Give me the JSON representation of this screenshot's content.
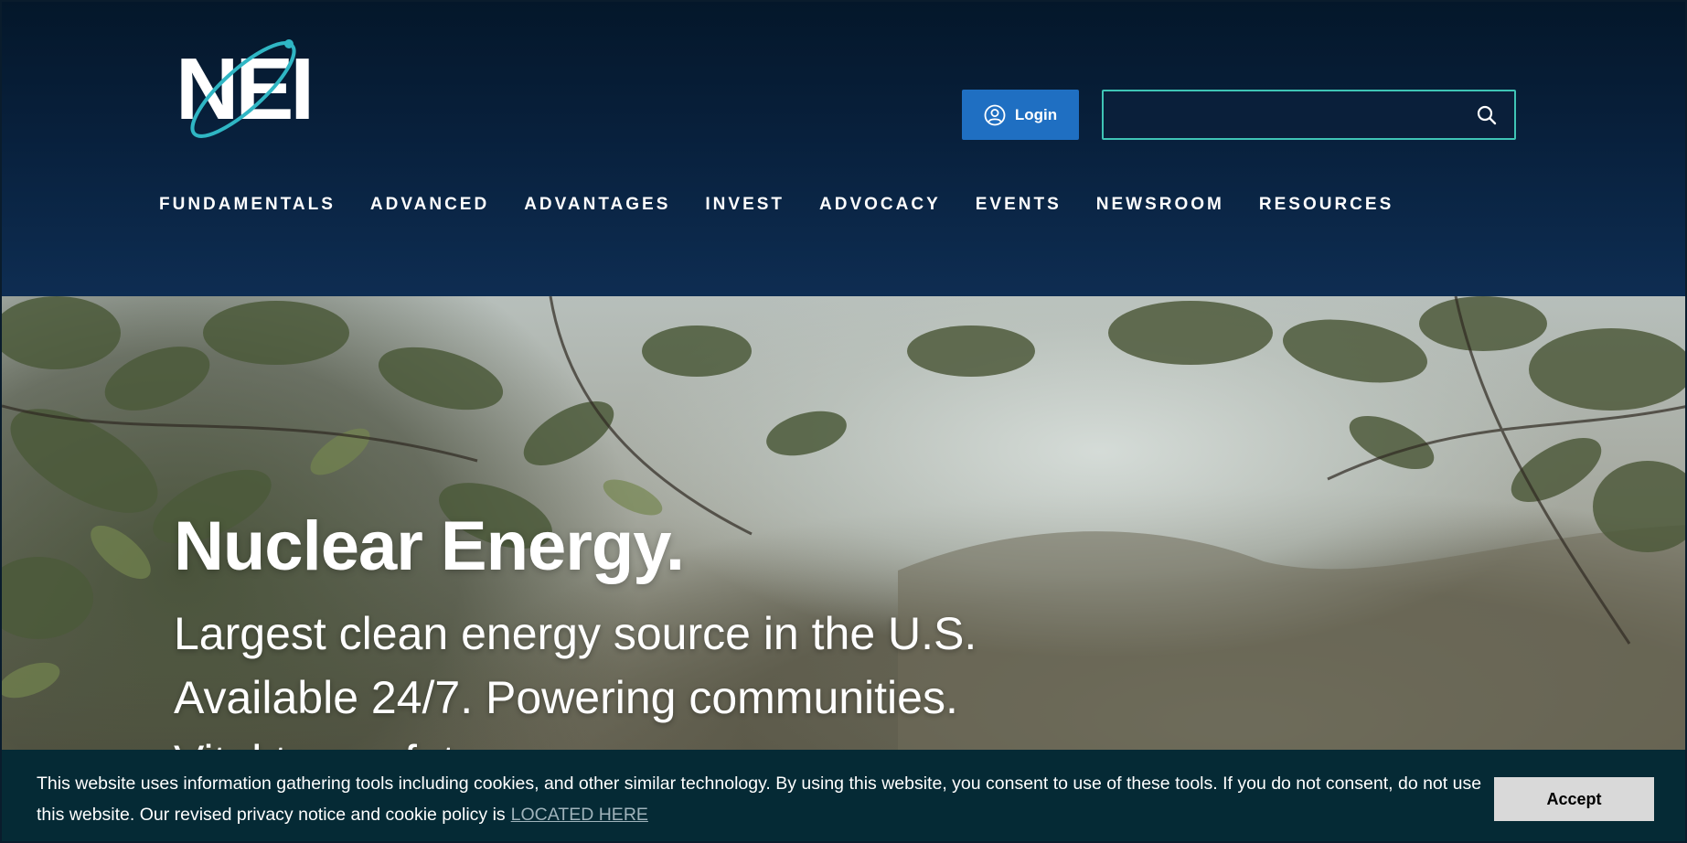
{
  "header": {
    "logo_text": "NEI",
    "login_label": "Login",
    "search": {
      "placeholder": "",
      "value": ""
    }
  },
  "nav": {
    "items": [
      {
        "label": "FUNDAMENTALS"
      },
      {
        "label": "ADVANCED"
      },
      {
        "label": "ADVANTAGES"
      },
      {
        "label": "INVEST"
      },
      {
        "label": "ADVOCACY"
      },
      {
        "label": "EVENTS"
      },
      {
        "label": "NEWSROOM"
      },
      {
        "label": "RESOURCES"
      }
    ]
  },
  "hero": {
    "title": "Nuclear Energy.",
    "line1": "Largest clean energy source in the U.S.",
    "line2": "Available 24/7. Powering communities.",
    "line3": "Vital to our future."
  },
  "cookie_banner": {
    "text": "This website uses information gathering tools including cookies, and other similar technology. By using this website, you consent to use of these tools. If you do not consent, do not use this website. Our revised privacy notice and cookie policy is",
    "link_label": "LOCATED HERE",
    "accept_label": "Accept"
  },
  "colors": {
    "header_dark": "#04172a",
    "header_light": "#0e2d52",
    "login_blue": "#1f6fc2",
    "search_border": "#3fc4b5",
    "logo_orbit": "#2fb6c4",
    "cookie_bg": "#052a35",
    "accept_bg": "#d9d9d9"
  }
}
